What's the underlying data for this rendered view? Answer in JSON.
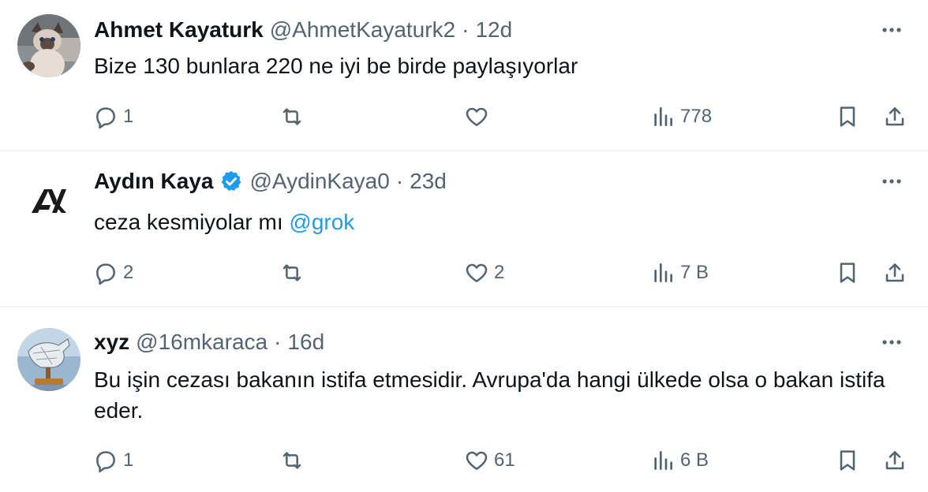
{
  "tweets": [
    {
      "name": "Ahmet Kayaturk",
      "verified": false,
      "handle": "@AhmetKayaturk2",
      "separator": "·",
      "time": "12d",
      "text": "Bize 130 bunlara 220 ne iyi be birde paylaşıyorlar",
      "mention": "",
      "avatar_icon": "cat-avatar",
      "replies": "1",
      "retweets": "",
      "likes": "",
      "views": "778"
    },
    {
      "name": "Aydın Kaya",
      "verified": true,
      "handle": "@AydinKaya0",
      "separator": "·",
      "time": "23d",
      "text": "ceza kesmiyolar mı ",
      "mention": "@grok",
      "avatar_icon": "ak-logo-avatar",
      "replies": "2",
      "retweets": "",
      "likes": "2",
      "views": "7 B"
    },
    {
      "name": "xyz",
      "verified": false,
      "handle": "@16mkaraca",
      "separator": "·",
      "time": "16d",
      "text": "Bu işin cezası bakanın istifa etmesidir. Avrupa'da hangi ülkede olsa o bakan istifa eder.",
      "mention": "",
      "avatar_icon": "horse-sculpture-avatar",
      "replies": "1",
      "retweets": "",
      "likes": "61",
      "views": "6 B"
    }
  ],
  "colors": {
    "text": "#0f1419",
    "muted": "#536471",
    "link": "#1d9bf0",
    "verified": "#1d9bf0",
    "divider": "#eff3f4"
  }
}
